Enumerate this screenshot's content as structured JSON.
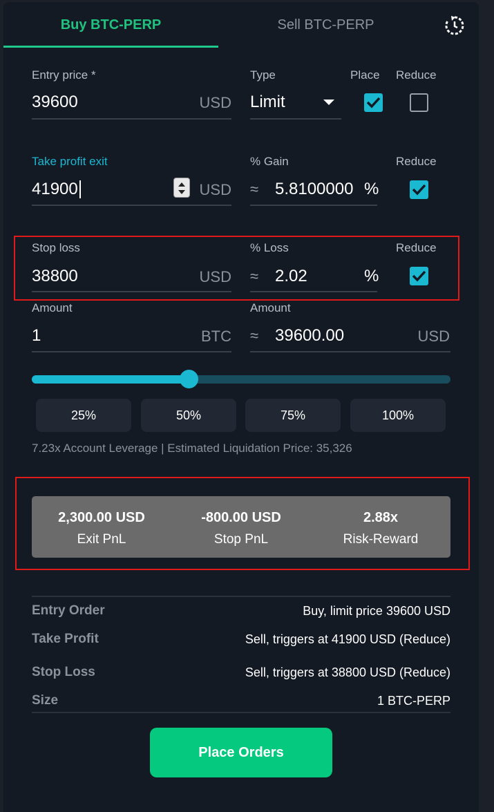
{
  "tabs": {
    "buy": "Buy BTC-PERP",
    "sell": "Sell BTC-PERP"
  },
  "entry": {
    "label": "Entry price *",
    "value": "39600",
    "unit": "USD",
    "type_label": "Type",
    "type_value": "Limit",
    "place_label": "Place",
    "place_checked": true,
    "reduce_label": "Reduce",
    "reduce_checked": false
  },
  "take_profit": {
    "label": "Take profit exit",
    "value": "41900",
    "unit": "USD",
    "gain_label": "% Gain",
    "approx": "≈",
    "gain_value": "5.8100000",
    "gain_unit": "%",
    "reduce_label": "Reduce",
    "reduce_checked": true
  },
  "stop_loss": {
    "label": "Stop loss",
    "value": "38800",
    "unit": "USD",
    "loss_label": "% Loss",
    "approx": "≈",
    "loss_value": "2.02",
    "loss_unit": "%",
    "reduce_label": "Reduce",
    "reduce_checked": true
  },
  "amount": {
    "label": "Amount",
    "value": "1",
    "unit": "BTC",
    "usd_label": "Amount",
    "approx": "≈",
    "usd_value": "39600.00",
    "usd_unit": "USD"
  },
  "slider": {
    "fraction": 0.375
  },
  "percent_buttons": [
    "25%",
    "50%",
    "75%",
    "100%"
  ],
  "leverage_text": "7.23x Account Leverage | Estimated Liquidation Price: 35,326",
  "pnl": [
    {
      "value": "2,300.00 USD",
      "label": "Exit PnL"
    },
    {
      "value": "-800.00 USD",
      "label": "Stop PnL"
    },
    {
      "value": "2.88x",
      "label": "Risk-Reward"
    }
  ],
  "summary": [
    {
      "label": "Entry Order",
      "value": "Buy, limit price 39600 USD"
    },
    {
      "label": "Take Profit",
      "value": "Sell, triggers at 41900 USD (Reduce)"
    },
    {
      "label": "Stop Loss",
      "value": "Sell, triggers at 38800 USD (Reduce)"
    },
    {
      "label": "Size",
      "value": "1 BTC-PERP"
    }
  ],
  "place_button": "Place Orders",
  "colors": {
    "accent_green": "#05c97e",
    "accent_cyan": "#1ab8d1",
    "highlight_red": "#e01919"
  }
}
